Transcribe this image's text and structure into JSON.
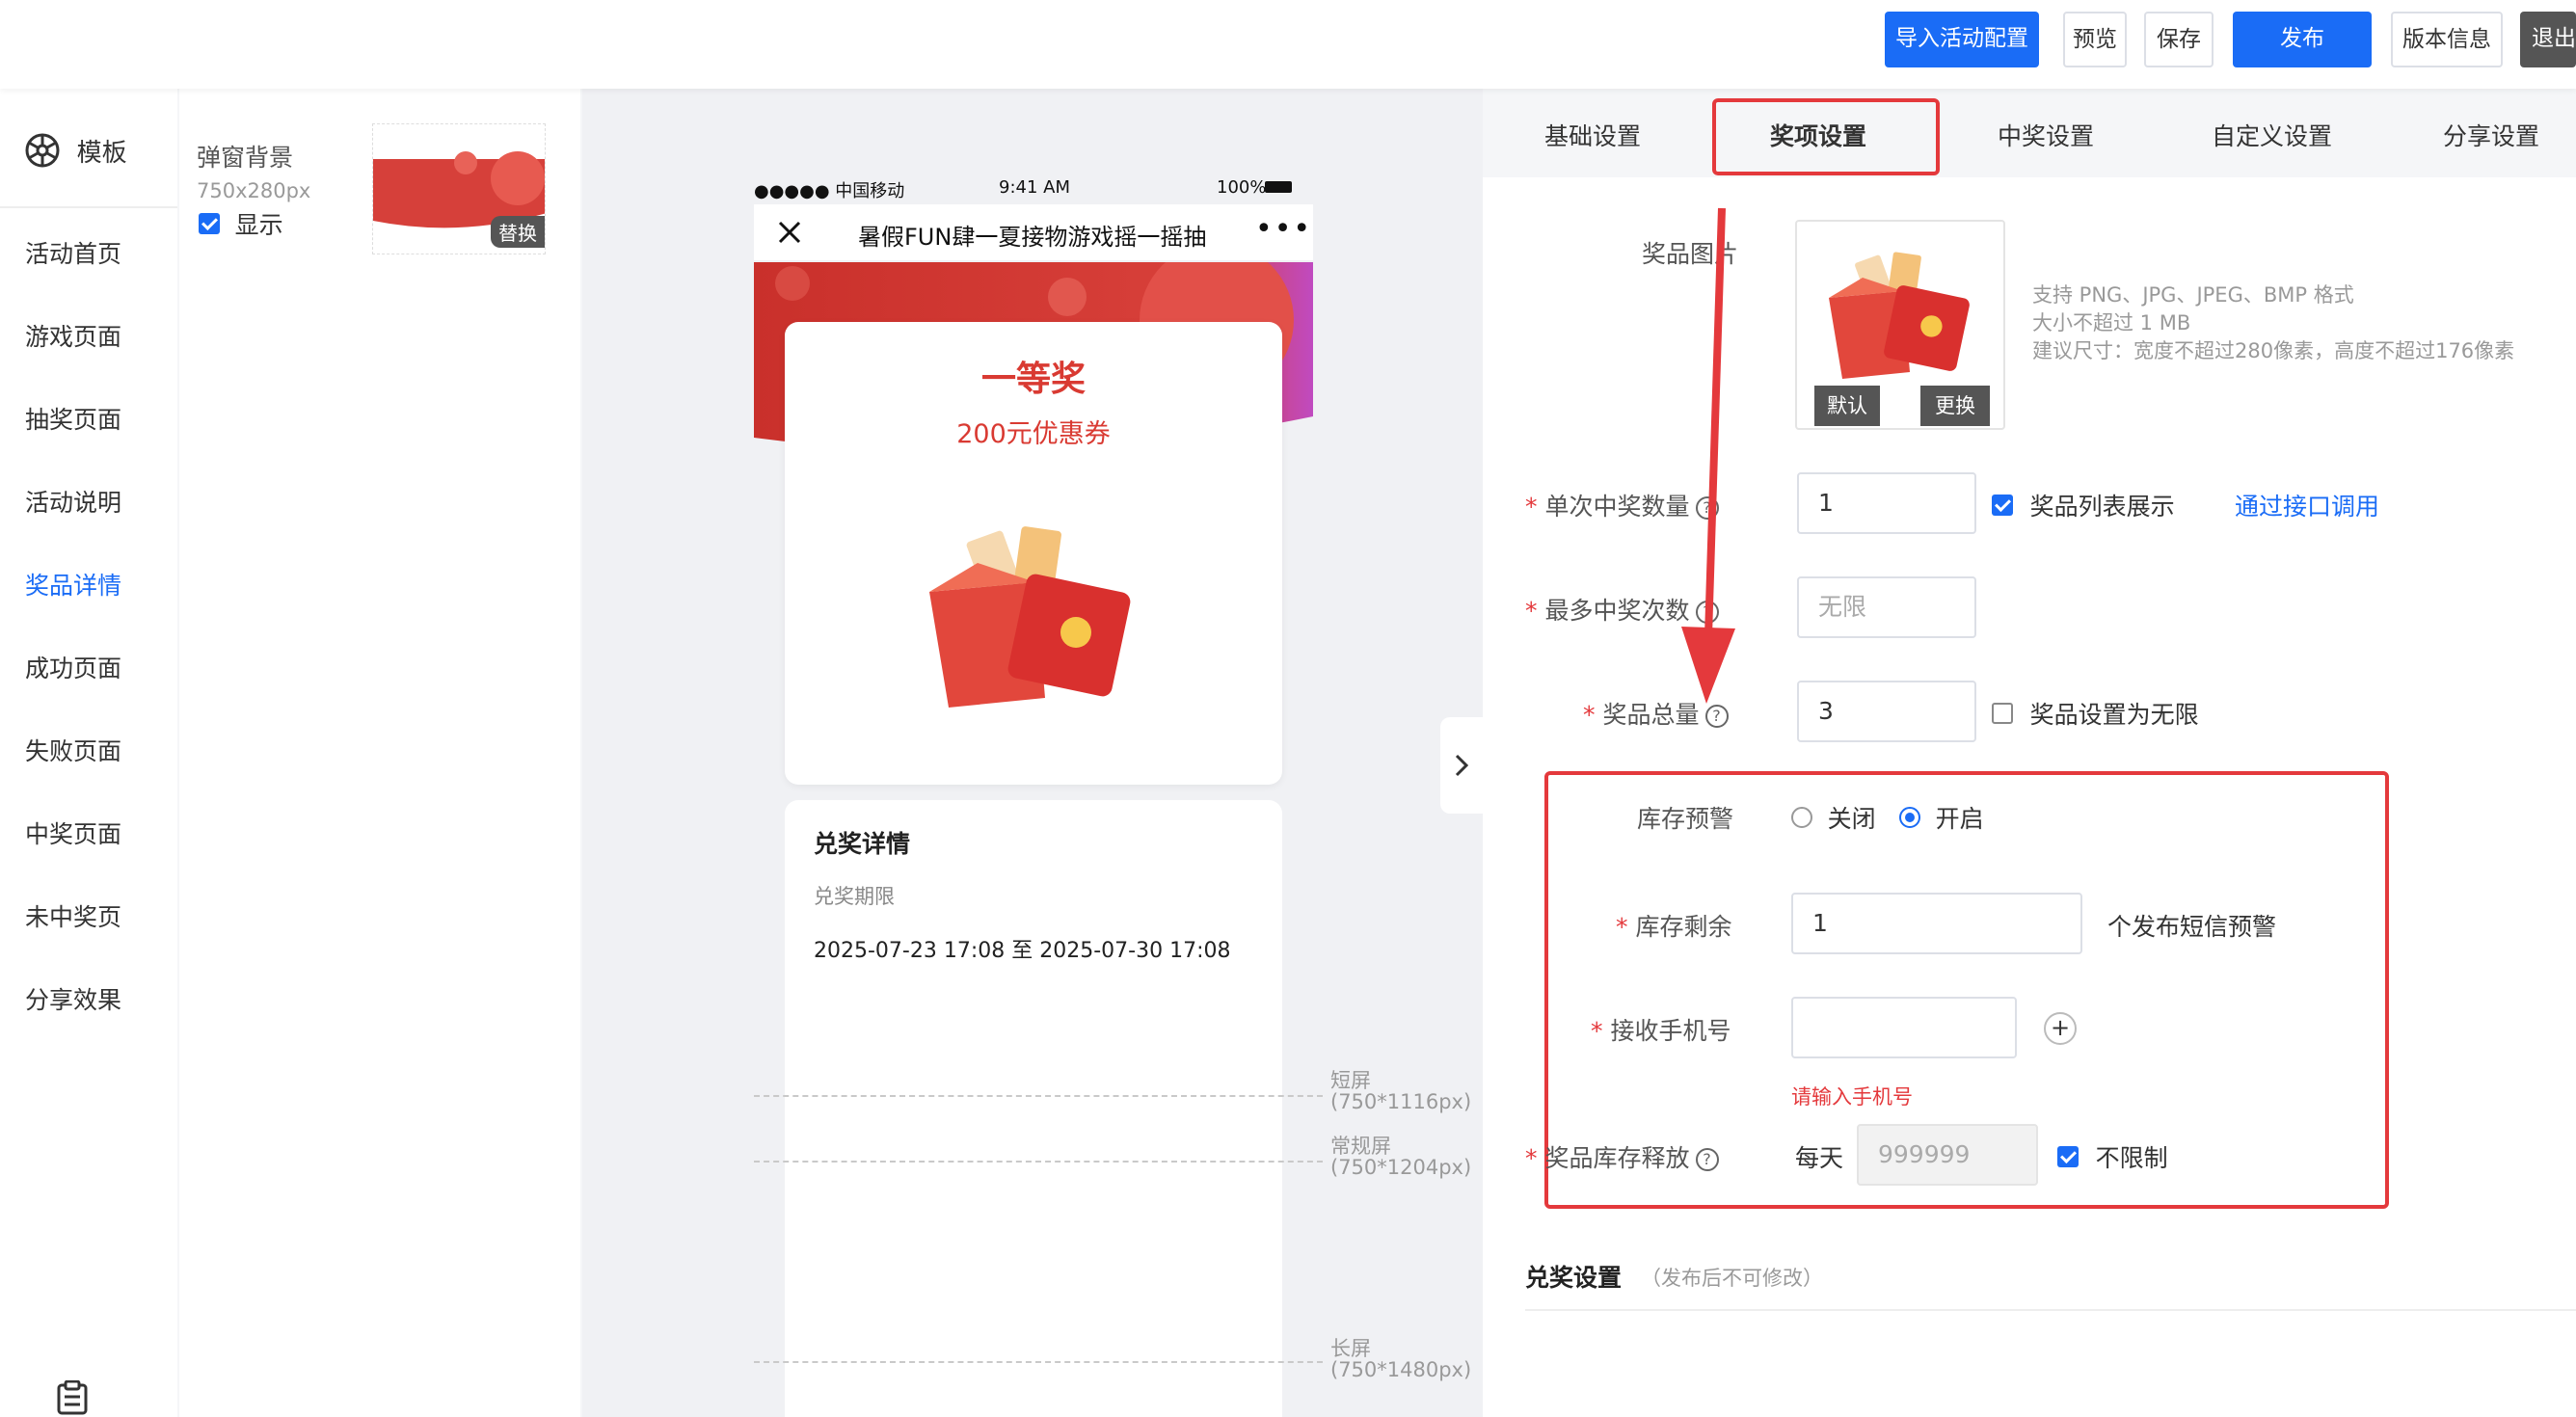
{
  "toolbar": {
    "import_label": "导入活动配置",
    "preview_label": "预览",
    "save_label": "保存",
    "publish_label": "发布",
    "version_label": "版本信息",
    "exit_label": "退出"
  },
  "leftnav": {
    "template_label": "模板",
    "items": [
      "活动首页",
      "游戏页面",
      "抽奖页面",
      "活动说明",
      "奖品详情",
      "成功页面",
      "失败页面",
      "中奖页面",
      "未中奖页",
      "分享效果"
    ],
    "active_index": 4
  },
  "component_panel": {
    "title": "弹窗背景",
    "size": "750x280px",
    "show_label": "显示",
    "replace_label": "替换"
  },
  "phone": {
    "carrier": "●●●●● 中国移动",
    "time": "9:41 AM",
    "battery": "100%",
    "title": "暑假FUN肆一夏接物游戏摇一摇抽",
    "prize_level": "一等奖",
    "prize_name": "200元优惠券",
    "redeem_title": "兑奖详情",
    "redeem_period_label": "兑奖期限",
    "redeem_period": "2025-07-23 17:08 至 2025-07-30 17:08"
  },
  "screen_markers": [
    {
      "name": "短屏",
      "size": "(750*1116px)"
    },
    {
      "name": "常规屏",
      "size": "(750*1204px)"
    },
    {
      "name": "长屏",
      "size": "(750*1480px)"
    }
  ],
  "tabs": [
    "基础设置",
    "奖项设置",
    "中奖设置",
    "自定义设置",
    "分享设置"
  ],
  "active_tab": "奖项设置",
  "form": {
    "prize_image_label": "奖品图片",
    "default_label": "默认",
    "change_label": "更换",
    "image_hint_1": "支持 PNG、JPG、JPEG、BMP 格式",
    "image_hint_2": "大小不超过 1 MB",
    "image_hint_3": "建议尺寸：宽度不超过280像素，高度不超过176像素",
    "single_win_label": "单次中奖数量",
    "single_win_value": "1",
    "show_in_list_label": "奖品列表展示",
    "api_link": "通过接口调用",
    "max_win_label": "最多中奖次数",
    "max_win_placeholder": "无限",
    "total_label": "奖品总量",
    "total_value": "3",
    "unlimited_label": "奖品设置为无限",
    "stock_alert_label": "库存预警",
    "alert_off": "关闭",
    "alert_on": "开启",
    "stock_left_label": "库存剩余",
    "stock_left_value": "1",
    "stock_left_suffix": "个发布短信预警",
    "phone_label": "接收手机号",
    "phone_error": "请输入手机号",
    "release_label": "奖品库存释放",
    "release_prefix": "每天",
    "release_placeholder": "999999",
    "no_limit_label": "不限制",
    "redeem_section": "兑奖设置",
    "redeem_note": "（发布后不可修改）"
  },
  "colors": {
    "primary": "#1a6cf6",
    "danger": "#e4393c",
    "prize_red": "#d93a32"
  }
}
